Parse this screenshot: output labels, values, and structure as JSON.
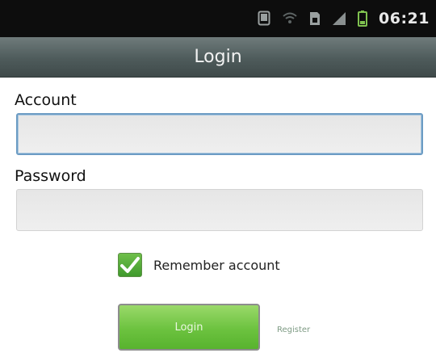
{
  "status_bar": {
    "time": "06:21",
    "icons": [
      "tablet-icon",
      "wifi-icon",
      "sim-card-icon",
      "signal-icon",
      "battery-icon"
    ]
  },
  "title_bar": {
    "title": "Login"
  },
  "form": {
    "account_label": "Account",
    "account_value": "",
    "password_label": "Password",
    "password_value": "",
    "remember_label": "Remember account",
    "remember_checked": true
  },
  "actions": {
    "login_label": "Login",
    "register_label": "Register"
  },
  "colors": {
    "status_bar_bg": "#0d0d0d",
    "title_bar_bg": "#4e5b5b",
    "accent_green": "#6cc23f",
    "focus_border": "#6c9cc4"
  }
}
